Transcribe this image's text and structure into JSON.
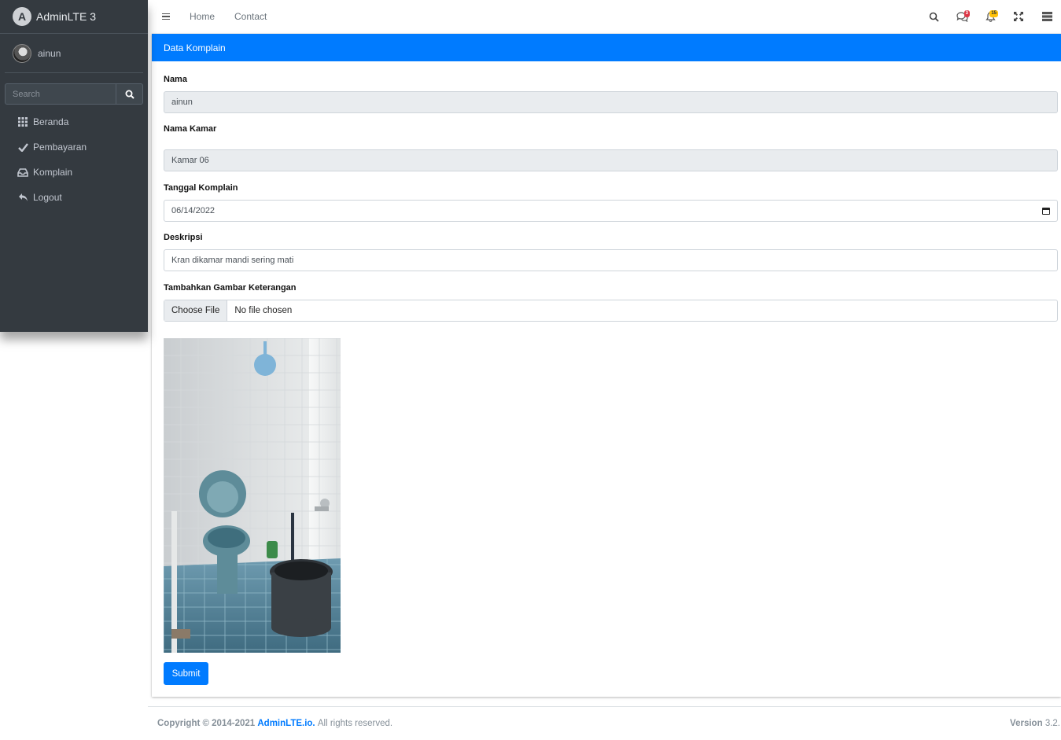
{
  "brand": {
    "name": "AdminLTE 3"
  },
  "user": {
    "name": "ainun"
  },
  "sidebar_search": {
    "placeholder": "Search"
  },
  "nav": [
    {
      "label": "Beranda",
      "icon": "grid-icon"
    },
    {
      "label": "Pembayaran",
      "icon": "check-icon"
    },
    {
      "label": "Komplain",
      "icon": "inbox-icon"
    },
    {
      "label": "Logout",
      "icon": "reply-icon"
    }
  ],
  "topnav": {
    "links": [
      "Home",
      "Contact"
    ],
    "messages_badge": "3",
    "notifications_badge": "15"
  },
  "card": {
    "title": "Data Komplain"
  },
  "form": {
    "nama_label": "Nama",
    "nama_value": "ainun",
    "kamar_label": "Nama Kamar",
    "kamar_value": "Kamar 06",
    "tanggal_label": "Tanggal Komplain",
    "tanggal_value": "06/14/2022",
    "deskripsi_label": "Deskripsi",
    "deskripsi_value": "Kran dikamar mandi sering mati",
    "gambar_label": "Tambahkan Gambar Keterangan",
    "file_button": "Choose File",
    "file_status": "No file chosen",
    "submit_label": "Submit"
  },
  "footer": {
    "copyright": "Copyright © 2014-2021",
    "link": "AdminLTE.io.",
    "rights": "All rights reserved.",
    "version_label": "Version",
    "version_value": "3.2."
  },
  "colors": {
    "primary": "#007bff",
    "sidebar": "#343a40",
    "danger": "#dc3545",
    "warning": "#ffc107"
  }
}
